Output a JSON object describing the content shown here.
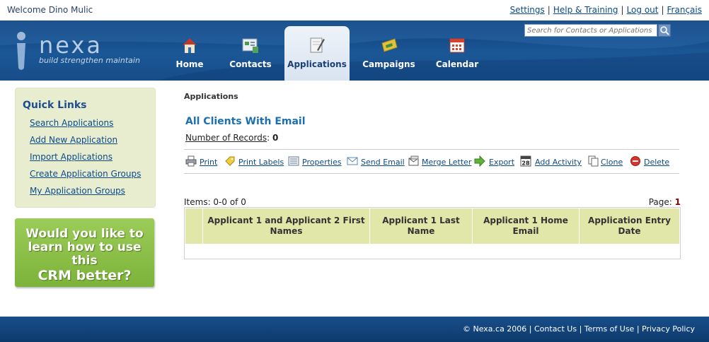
{
  "topbar": {
    "welcome": "Welcome Dino Mulic",
    "links": [
      "Settings",
      "Help & Training",
      "Log out",
      "Français"
    ]
  },
  "header": {
    "logo_name": "nexa",
    "logo_tagline": "build strengthen maintain",
    "search_placeholder": "Search for Contacts or Applications",
    "nav": [
      {
        "label": "Home",
        "icon": "home-icon"
      },
      {
        "label": "Contacts",
        "icon": "contacts-icon"
      },
      {
        "label": "Applications",
        "icon": "applications-icon",
        "active": true
      },
      {
        "label": "Campaigns",
        "icon": "campaigns-icon"
      },
      {
        "label": "Calendar",
        "icon": "calendar-icon"
      }
    ]
  },
  "sidebar": {
    "title": "Quick Links",
    "links": [
      "Search Applications",
      "Add New Application",
      "Import Applications",
      "Create Application Groups",
      "My Application Groups"
    ],
    "promo": [
      "Would you like to",
      "learn how to use this",
      "CRM better?"
    ]
  },
  "main": {
    "breadcrumb": "Applications",
    "title": "All Clients With Email",
    "records_label": "Number of Records",
    "records_sep": ":",
    "records_value": "0",
    "toolbar": [
      "Print",
      "Print Labels",
      "Properties",
      "Send Email",
      "Merge Letter",
      "Export",
      "Add Activity",
      "Clone",
      "Delete"
    ],
    "items_text": "Items: 0-0 of 0",
    "page_label": "Page:",
    "page_value": "1",
    "columns": [
      "Applicant 1 and Applicant 2 First Names",
      "Applicant 1 Last Name",
      "Applicant 1 Home Email",
      "Application Entry Date"
    ]
  },
  "footer": {
    "copyright": "© Nexa.ca 2006",
    "links": [
      "Contact Us",
      "Terms of Use",
      "Privacy Policy"
    ]
  },
  "colors": {
    "header_blue": "#1b5796",
    "link_blue": "#0b4a8a",
    "title_blue": "#1d6fb0",
    "sidebar_bg": "#e9edcf",
    "grid_header": "#e1e7a9",
    "promo_green": "#8cbf47"
  }
}
